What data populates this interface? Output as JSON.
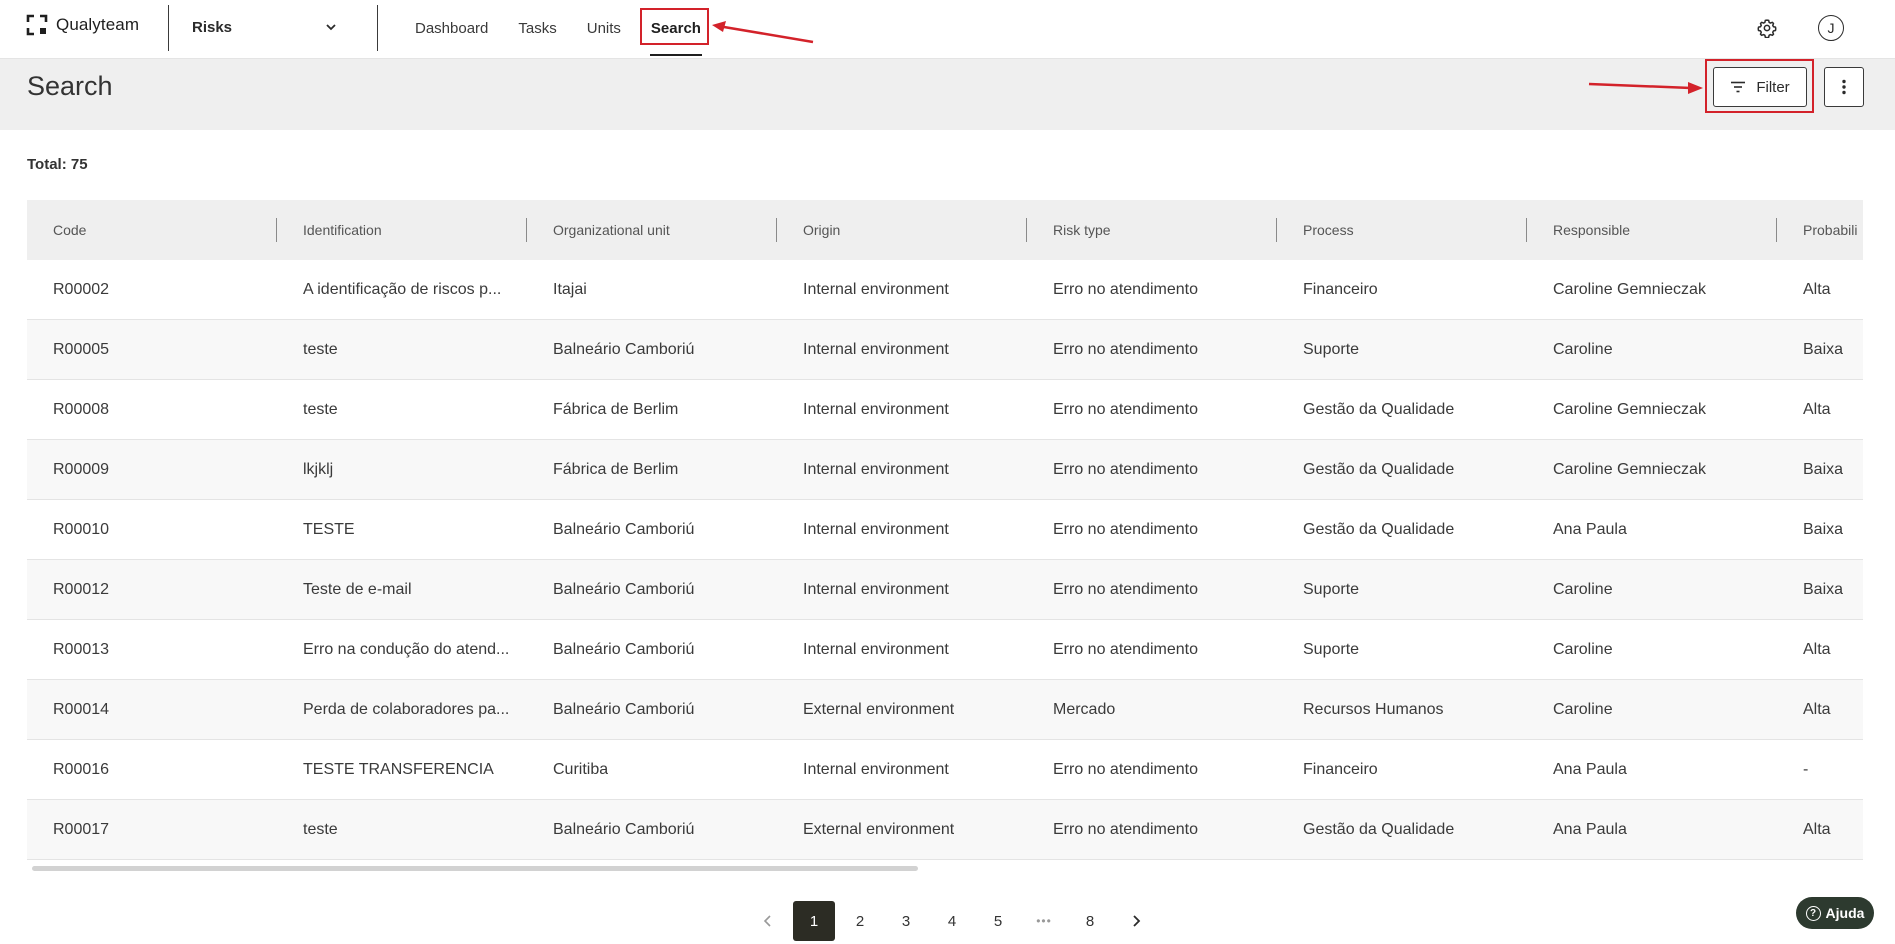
{
  "app": {
    "brand": "Qualyteam"
  },
  "module_select": {
    "value": "Risks"
  },
  "nav": [
    {
      "label": "Dashboard",
      "active": false
    },
    {
      "label": "Tasks",
      "active": false
    },
    {
      "label": "Units",
      "active": false
    },
    {
      "label": "Search",
      "active": true
    }
  ],
  "header": {
    "title": "Search",
    "filter_label": "Filter"
  },
  "user": {
    "initial": "J"
  },
  "total": {
    "label": "Total: 75"
  },
  "table": {
    "columns": [
      "Code",
      "Identification",
      "Organizational unit",
      "Origin",
      "Risk type",
      "Process",
      "Responsible",
      "Probabili"
    ],
    "rows": [
      [
        "R00002",
        "A identificação de riscos p...",
        "Itajai",
        "Internal environment",
        "Erro no atendimento",
        "Financeiro",
        "Caroline Gemnieczak",
        "Alta"
      ],
      [
        "R00005",
        "teste",
        "Balneário Camboriú",
        "Internal environment",
        "Erro no atendimento",
        "Suporte",
        "Caroline",
        "Baixa"
      ],
      [
        "R00008",
        "teste",
        "Fábrica de Berlim",
        "Internal environment",
        "Erro no atendimento",
        "Gestão da Qualidade",
        "Caroline Gemnieczak",
        "Alta"
      ],
      [
        "R00009",
        "lkjklj",
        "Fábrica de Berlim",
        "Internal environment",
        "Erro no atendimento",
        "Gestão da Qualidade",
        "Caroline Gemnieczak",
        "Baixa"
      ],
      [
        "R00010",
        "TESTE",
        "Balneário Camboriú",
        "Internal environment",
        "Erro no atendimento",
        "Gestão da Qualidade",
        "Ana Paula",
        "Baixa"
      ],
      [
        "R00012",
        "Teste de e-mail",
        "Balneário Camboriú",
        "Internal environment",
        "Erro no atendimento",
        "Suporte",
        "Caroline",
        "Baixa"
      ],
      [
        "R00013",
        "Erro na condução do atend...",
        "Balneário Camboriú",
        "Internal environment",
        "Erro no atendimento",
        "Suporte",
        "Caroline",
        "Alta"
      ],
      [
        "R00014",
        "Perda de colaboradores pa...",
        "Balneário Camboriú",
        "External environment",
        "Mercado",
        "Recursos Humanos",
        "Caroline",
        "Alta"
      ],
      [
        "R00016",
        "TESTE TRANSFERENCIA",
        "Curitiba",
        "Internal environment",
        "Erro no atendimento",
        "Financeiro",
        "Ana Paula",
        "-"
      ],
      [
        "R00017",
        "teste",
        "Balneário Camboriú",
        "External environment",
        "Erro no atendimento",
        "Gestão da Qualidade",
        "Ana Paula",
        "Alta"
      ]
    ]
  },
  "pagination": {
    "pages": [
      "1",
      "2",
      "3",
      "4",
      "5",
      "8"
    ],
    "ellipsis": "•••",
    "current": "1"
  },
  "help": {
    "label": "Ajuda"
  },
  "colors": {
    "highlight": "#d3222a",
    "dark": "#2c2c24",
    "help_bg": "#2d3a2f"
  },
  "icons": [
    "qualyteam-logo-icon",
    "chevron-down-icon",
    "gear-icon",
    "filter-icon",
    "more-vertical-icon",
    "chevron-left-icon",
    "chevron-right-icon",
    "help-icon"
  ]
}
